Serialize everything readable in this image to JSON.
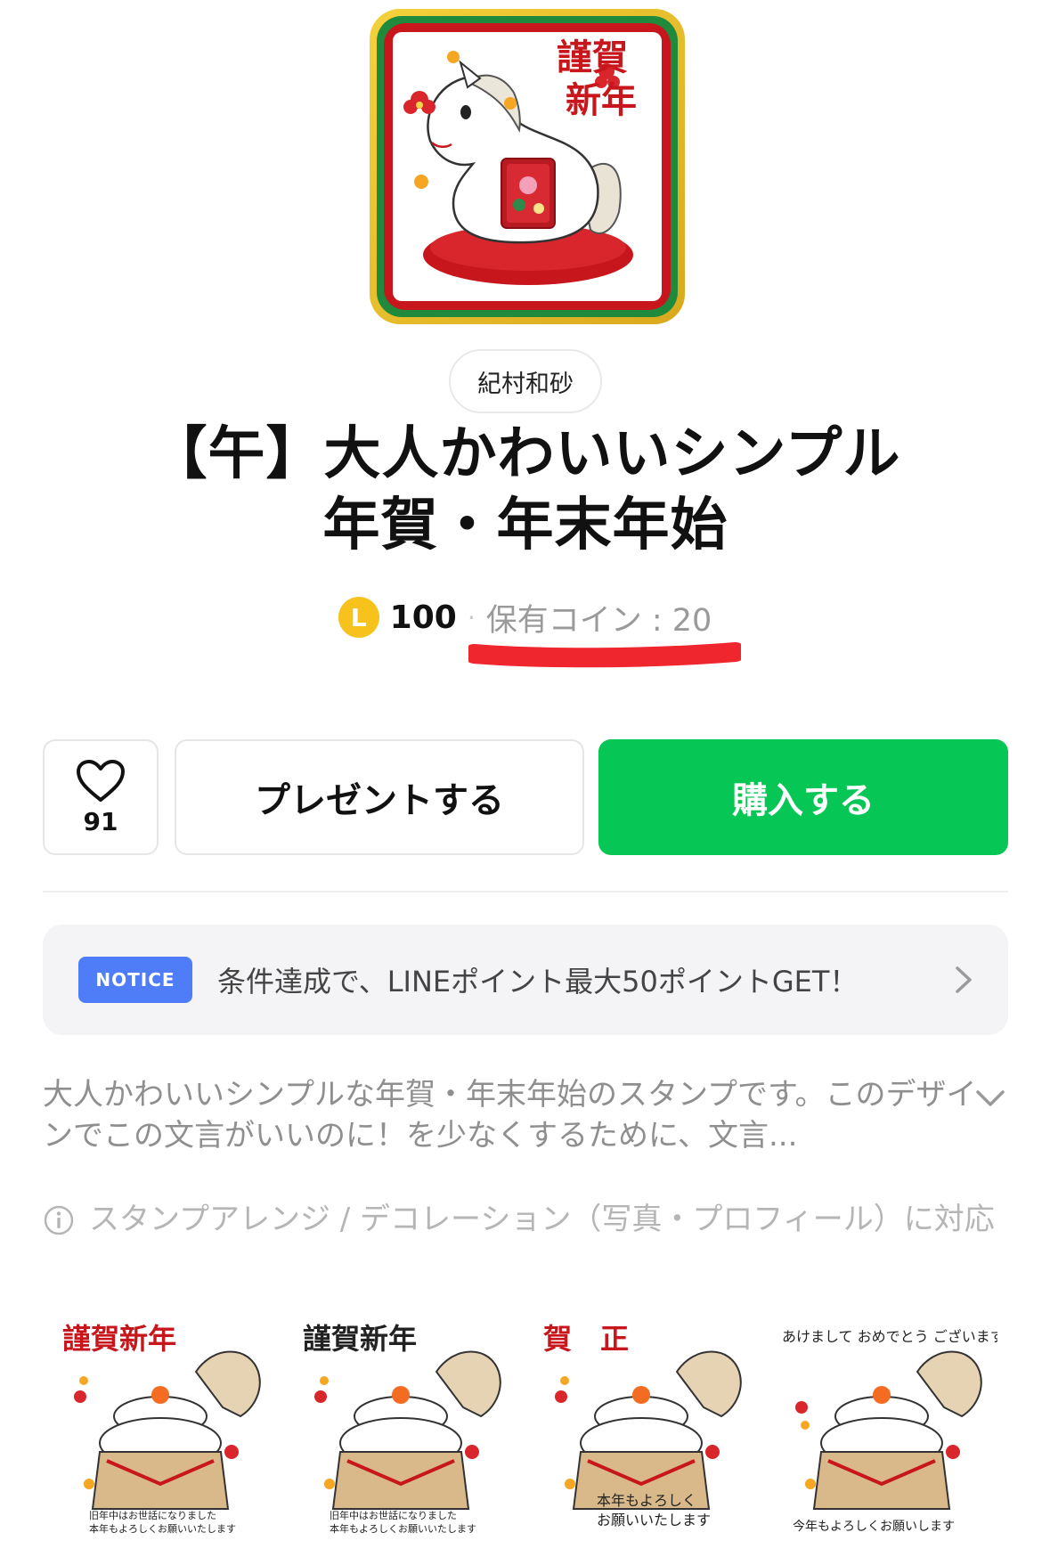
{
  "product": {
    "author": "紀村和砂",
    "title_line1": "【午】大人かわいいシンプル",
    "title_line2": "年賀・年末年始",
    "price": "100",
    "coin_icon_label": "L",
    "owned_coins": "保有コイン : 20",
    "hero_text_1": "謹賀",
    "hero_text_2": "新年"
  },
  "actions": {
    "like_count": "91",
    "present_label": "プレゼントする",
    "buy_label": "購入する"
  },
  "notice": {
    "badge": "NOTICE",
    "text": "条件達成で、LINEポイント最大50ポイントGET！"
  },
  "description": {
    "text": "大人かわいいシンプルな年賀・年末年始のスタンプです。このデザインでこの文言がいいのに！を少なくするために、文言..."
  },
  "feature_note": {
    "text": "スタンプアレンジ / デコレーション（写真・プロフィール）に対応"
  },
  "stickers": [
    {
      "caption": "謹賀新年",
      "footer_1": "旧年中はお世話になりました",
      "footer_2": "本年もよろしくお願いいたします"
    },
    {
      "caption": "謹賀新年",
      "footer_1": "旧年中はお世話になりました",
      "footer_2": "本年もよろしくお願いいたします"
    },
    {
      "caption": "賀　正",
      "footer_1": "本年もよろしく",
      "footer_2": "お願いいたします"
    },
    {
      "caption": "あけまして\nおめでとう\nございます",
      "footer_1": "",
      "footer_2": "今年もよろしくお願いします"
    }
  ],
  "colors": {
    "buy_green": "#06c755",
    "notice_blue": "#4f7df7",
    "coin_yellow": "#f6c21b",
    "festive_red": "#c8161d"
  },
  "icons": {
    "like": "heart-icon",
    "notice_arrow": "chevron-right-icon",
    "expand": "chevron-down-icon",
    "info": "info-icon"
  }
}
